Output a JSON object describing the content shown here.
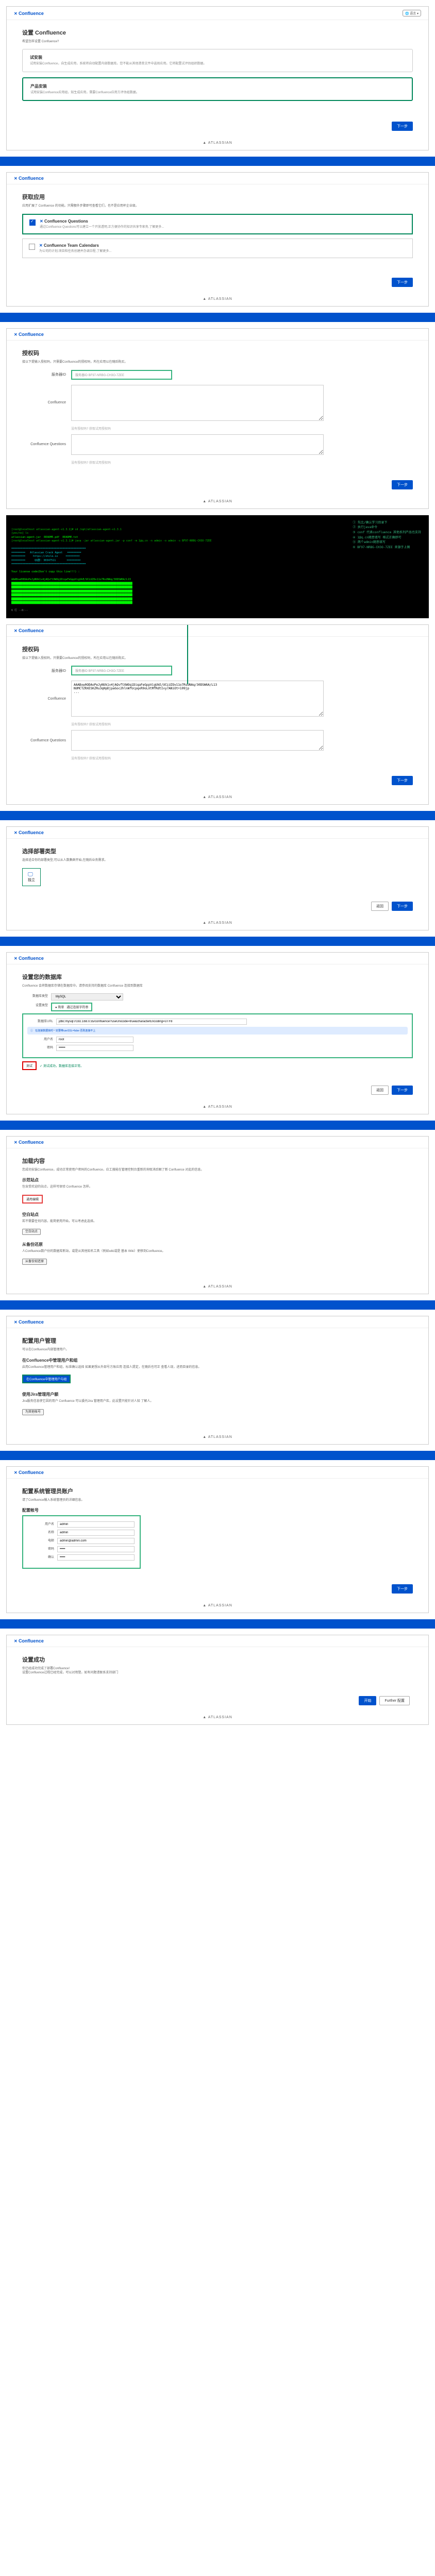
{
  "brand": "Confluence",
  "atlassian": "ATLASSIAN",
  "langBtn": "🌐 语言 ▾",
  "step1": {
    "title": "设置 Confluence",
    "subtitle": "希望怎样设置 Confluence?",
    "trial": {
      "title": "试安装",
      "desc": "试用安装Confluence，自生成应用，系统将自动配置内部数据库。您不能从其他清单文件中选择应用。它将配置试评估组织数据。"
    },
    "prod": {
      "title": "产品安装",
      "desc": "试用安装Confluence应用组，知生成应用，需要Confluence应用方评估组数据。"
    }
  },
  "step2": {
    "title": "获取应用",
    "desc": "应用扩展了 Confluence 的功能。只需额外步骤即可查看它们，也不是应用杯企业级。",
    "q": {
      "title": "Confluence Questions",
      "desc": "通过Confluence Questions可以建立一个开放透明,正方便协作的知识共享专家务,了解更多..."
    },
    "cal": {
      "title": "Confluence Team Calendars",
      "desc": "为公司的计划,项目和任务创建并办调日程,了解更多..."
    }
  },
  "step3": {
    "title": "授权码",
    "desc": "接以下提输入授权码，只需要Confluence的授权码，所在应用以在随后购买。",
    "serverLabel": "服务器ID",
    "serverVal": "服务器ID BF97-NRBG-CH3O-7ZEE",
    "confluenceLabel": "Confluence",
    "qLabel": "Confluence Questions",
    "noKey": "没有授权码? 获取试用授权码",
    "ta_content": "AAABxw0ODAoPeJyNUk1v4jAQvftXWOq1DiqaFeGppVigUkE/UCLUZOv11o7RsUNAq/30DSW6A/L13\nNUMCTZRXESKZRu3qHpDjpaGoc2hlnWfUcpqxR9oLXtMfRdtIvy7ANiOt+109jp\n...",
    "noKey2": "没有授权码? 获取试用授权码"
  },
  "terminal": {
    "line1": "[root@localhost atlassian-agent-v1.3.1]# cd /opt/atlassian-agent-v1.3.1",
    "line2": "[yes/no] ls",
    "line3": "atlassian-agent.jar  README.pdf  README.txt",
    "line4": "[root@localhost atlassian-agent-v1.3.1]# java -jar atlassian-agent.jar -p conf -m 1@q.cn -n admin -o admin -s BF97-NRBG-CH3O-7ZEE",
    "agent": "================================================\n=========   Atlassian Crack Agent   =========\n=========     https://zhile.io     =========\n=========      QQ群: 30347511       =========\n================================================",
    "yourLine": "Your license code(Don't copy this line!!!) :",
    "notes": "① 先比/确认学习目录下\n② 执行java命令\n③ conf 代表confluence 其他系列产品也支持\n④ 1@q.cn随意填写 格式正确即可\n⑤ 两个admin随意填写\n⑥ BF97-NRBG-CH3O-7ZEE 来源于上图"
  },
  "step4": {
    "title": "选择部署类型",
    "desc": "选择适合你的部署类型,可以从人数集群开始,在随后业务需求。",
    "standalone": "独立",
    "btnBack": "返回"
  },
  "step5": {
    "title": "设置您的数据库",
    "desc": "Confluence 会将数据库存储在数据库中。请参阅支持的数据库 Confluence 连接到数据库",
    "dbTypeLabel": "数据库类型",
    "dbType": "MySQL",
    "setupLabel": "设置类型",
    "simple": "● 简单",
    "byConn": "通过连接字符串",
    "hostLabel": "数据库URL",
    "hostVal": "jdbc:mysql://192.168.0.55/confluence?useUnicode=true&characterEncoding=UTF8",
    "infoBox": "在连接数据库时一定要带useSSL=false 否则连接不上",
    "userLabel": "用户名",
    "userVal": "root",
    "pwdLabel": "密码",
    "testBtn": "测试",
    "testOk": "测试成功，数据库连接正常。"
  },
  "step6": {
    "title": "加载内容",
    "desc": "您成功安装Confluence，成功正常使用户密码的Confluence，应工搜能在管理控制台重新的询取消后解了新 Confluence 对此的信息。",
    "demo": {
      "h": "示范站点",
      "d": "包含受欢迎的站点，这样可体验 Confluence 怎样。",
      "btn": "通用编辑"
    },
    "empty": {
      "h": "空白站点",
      "d": "若不需要任何内容，能简使用开始，可以考虑此选择。",
      "btn": "空白站点"
    },
    "restore": {
      "h": "从备份还原",
      "d": "人Confluence数户份的数据库新站，或是从其他知名工具（例如wiki或是 基本 Wiki）使移到Confluence。",
      "btn": "从备份如还原"
    }
  },
  "step7": {
    "title": "配置用户管理",
    "desc": "可以在Confluence内部管理用户。",
    "sub1": {
      "h": "在Confluence中管理用户和组",
      "d": "启用Confluence管理用户和组，标准确认选择 如果更想从外部号方账应用 连接人提定，在随后也可正 查看人现，进而目录的信息。",
      "btn": "在Confluence中管理用户与组"
    },
    "sub2": {
      "h": "使用Jira管理用户额",
      "d": "Jira服务信息使它因的用户 Confluence 可以委托Jira 管理用户库，此设置只能针对人知 了解人。",
      "btn": "为其他帐号"
    }
  },
  "step8": {
    "title": "配置系统管理员账户",
    "desc": "请了Confluence输入系统管理员的详细信息。",
    "sub": "配置帐号",
    "userLabel": "用户名",
    "userVal": "admin",
    "nameLabel": "名称",
    "nameVal": "admin",
    "emailLabel": "电邮",
    "emailVal": "admin@admin.com",
    "pwdLabel": "密码",
    "cpwdLabel": "确认"
  },
  "step9": {
    "title": "设置成功",
    "desc": "你已经成功完成了部署Confluence!\n设置Confluence过程已经完成，可以对用登。如有问题请联系支持部门",
    "btnStart": "开始"
  },
  "next": "下一步",
  "further": "Further 配置"
}
